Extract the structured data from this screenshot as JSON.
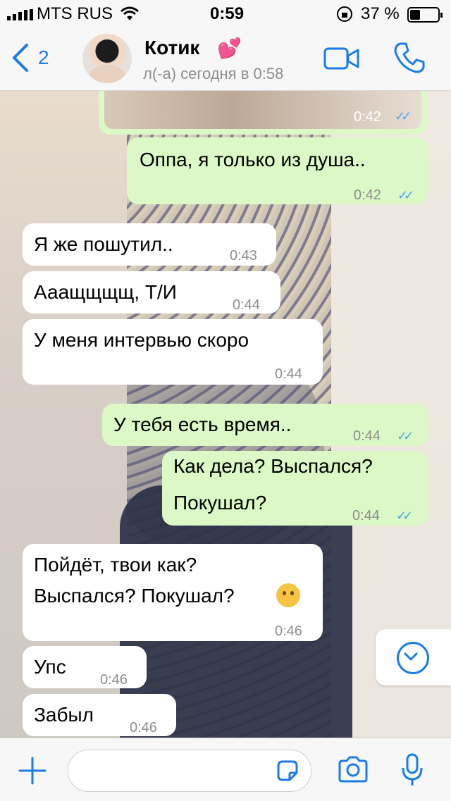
{
  "status_bar": {
    "carrier": "MTS RUS",
    "time": "0:59",
    "battery": "37 %"
  },
  "header": {
    "back_count": "2",
    "contact_name": "Котик",
    "contact_emoji": "💕",
    "status": "л(-а) сегодня в 0:58",
    "icons": [
      "back-chevron-icon",
      "video-call-icon",
      "phone-icon"
    ]
  },
  "messages": [
    {
      "dir": "out",
      "type": "image",
      "time": "0:42",
      "read": true
    },
    {
      "dir": "out",
      "text": "Оппа, я только из душа..",
      "time": "0:42",
      "read": true
    },
    {
      "dir": "in",
      "text": "Я же пошутил..",
      "time": "0:43"
    },
    {
      "dir": "in",
      "text": "Ааащщщщ, Т/И",
      "time": "0:44"
    },
    {
      "dir": "in",
      "text": "У меня интервью скоро",
      "time": "0:44"
    },
    {
      "dir": "out",
      "text": "У тебя есть время..",
      "time": "0:44",
      "read": true
    },
    {
      "dir": "out",
      "line1": "Как дела? Выспался?",
      "line2": "Покушал?",
      "time": "0:44",
      "read": true
    },
    {
      "dir": "in",
      "line1": "Пойдёт, твои как?",
      "line2": "Выспался? Покушал?",
      "emoji": "thinking-face-icon",
      "time": "0:46"
    },
    {
      "dir": "in",
      "text": "Упс",
      "time": "0:46"
    },
    {
      "dir": "in",
      "text": "Забыл",
      "time": "0:46"
    }
  ],
  "footer": {
    "icons": [
      "plus-icon",
      "sticker-icon",
      "camera-icon",
      "microphone-icon"
    ]
  },
  "colors": {
    "accent": "#1a7ce8",
    "outgoing_bubble": "#dcf8c6",
    "incoming_bubble": "#ffffff",
    "read_ticks": "#4fa9e8"
  }
}
